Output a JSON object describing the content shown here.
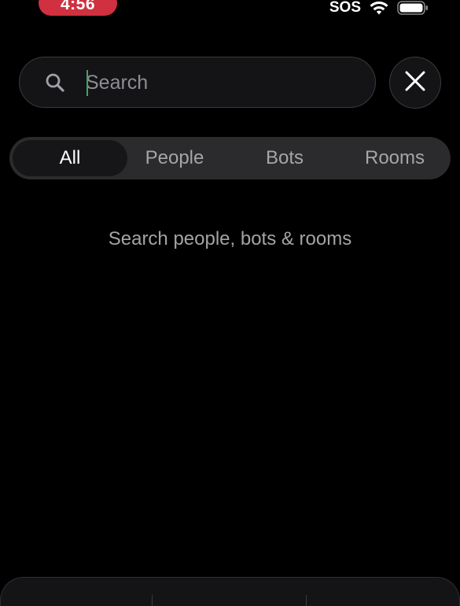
{
  "status_bar": {
    "time": "4:56",
    "sos": "SOS",
    "icons": [
      "wifi-icon",
      "battery-icon"
    ]
  },
  "search": {
    "placeholder": "Search",
    "value": "",
    "icon": "search-icon",
    "close_icon": "close-icon"
  },
  "tabs": [
    {
      "label": "All",
      "active": true
    },
    {
      "label": "People",
      "active": false
    },
    {
      "label": "Bots",
      "active": false
    },
    {
      "label": "Rooms",
      "active": false
    }
  ],
  "empty_state": {
    "message": "Search people, bots & rooms"
  },
  "colors": {
    "background": "#000000",
    "time_pill": "#d0303f",
    "caret": "#3fa46a",
    "surface": "#141416",
    "tabs_track": "#2b2b2e"
  }
}
